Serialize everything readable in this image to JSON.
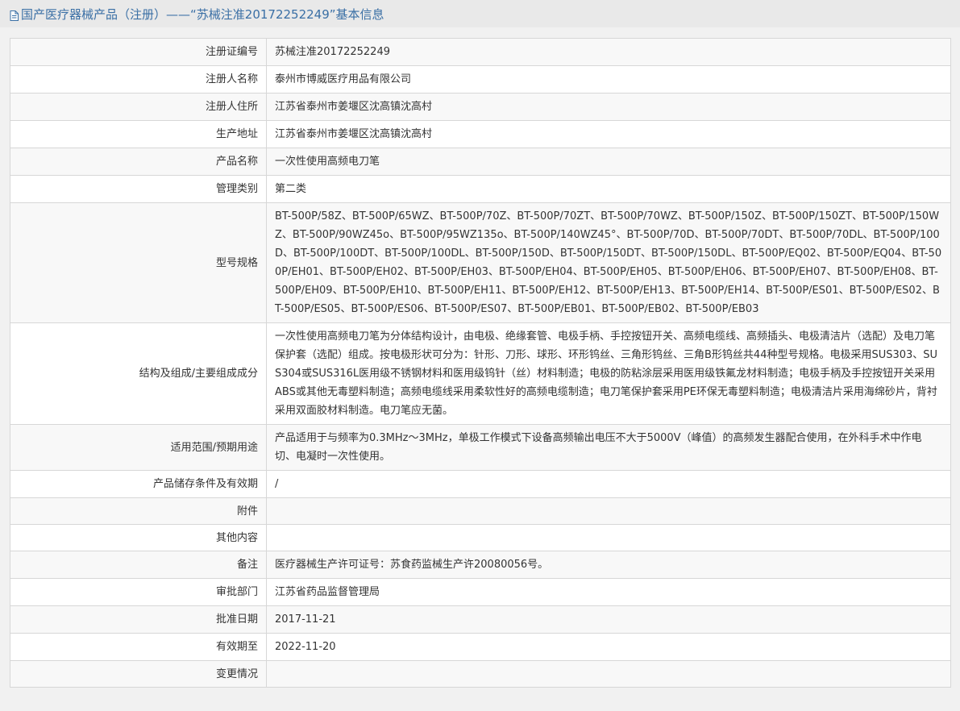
{
  "header": {
    "icon": "document-icon",
    "title": "国产医疗器械产品（注册）——“苏械注准20172252249”基本信息"
  },
  "rows": [
    {
      "label": "注册证编号",
      "value": "苏械注准20172252249"
    },
    {
      "label": "注册人名称",
      "value": "泰州市博威医疗用品有限公司"
    },
    {
      "label": "注册人住所",
      "value": "江苏省泰州市姜堰区沈高镇沈高村"
    },
    {
      "label": "生产地址",
      "value": "江苏省泰州市姜堰区沈高镇沈高村"
    },
    {
      "label": "产品名称",
      "value": "一次性使用高频电刀笔"
    },
    {
      "label": "管理类别",
      "value": "第二类"
    },
    {
      "label": "型号规格",
      "value": "BT-500P/58Z、BT-500P/65WZ、BT-500P/70Z、BT-500P/70ZT、BT-500P/70WZ、BT-500P/150Z、BT-500P/150ZT、BT-500P/150WZ、BT-500P/90WZ45o、BT-500P/95WZ135o、BT-500P/140WZ45°、BT-500P/70D、BT-500P/70DT、BT-500P/70DL、BT-500P/100D、BT-500P/100DT、BT-500P/100DL、BT-500P/150D、BT-500P/150DT、BT-500P/150DL、BT-500P/EQ02、BT-500P/EQ04、BT-500P/EH01、BT-500P/EH02、BT-500P/EH03、BT-500P/EH04、BT-500P/EH05、BT-500P/EH06、BT-500P/EH07、BT-500P/EH08、BT-500P/EH09、BT-500P/EH10、BT-500P/EH11、BT-500P/EH12、BT-500P/EH13、BT-500P/EH14、BT-500P/ES01、BT-500P/ES02、BT-500P/ES05、BT-500P/ES06、BT-500P/ES07、BT-500P/EB01、BT-500P/EB02、BT-500P/EB03"
    },
    {
      "label": "结构及组成/主要组成成分",
      "value": "一次性使用高频电刀笔为分体结构设计，由电极、绝缘套管、电极手柄、手控按钮开关、高频电缆线、高频插头、电极清洁片（选配）及电刀笔保护套（选配）组成。按电极形状可分为：针形、刀形、球形、环形钨丝、三角形钨丝、三角B形钨丝共44种型号规格。电极采用SUS303、SUS304或SUS316L医用级不锈钢材料和医用级钨针（丝）材料制造；电极的防粘涂层采用医用级铁氟龙材料制造；电极手柄及手控按钮开关采用ABS或其他无毒塑料制造；高频电缆线采用柔软性好的高频电缆制造；电刀笔保护套采用PE环保无毒塑料制造；电极清洁片采用海绵砂片，背衬采用双面胶材料制造。电刀笔应无菌。"
    },
    {
      "label": "适用范围/预期用途",
      "value": "产品适用于与频率为0.3MHz～3MHz，单极工作模式下设备高频输出电压不大于5000V（峰值）的高频发生器配合使用，在外科手术中作电切、电凝时一次性使用。"
    },
    {
      "label": "产品储存条件及有效期",
      "value": "/"
    },
    {
      "label": "附件",
      "value": ""
    },
    {
      "label": "其他内容",
      "value": ""
    },
    {
      "label": "备注",
      "value": "医疗器械生产许可证号：苏食药监械生产许20080056号。"
    },
    {
      "label": "审批部门",
      "value": "江苏省药品监督管理局"
    },
    {
      "label": "批准日期",
      "value": "2017-11-21"
    },
    {
      "label": "有效期至",
      "value": "2022-11-20"
    },
    {
      "label": "变更情况",
      "value": ""
    }
  ]
}
